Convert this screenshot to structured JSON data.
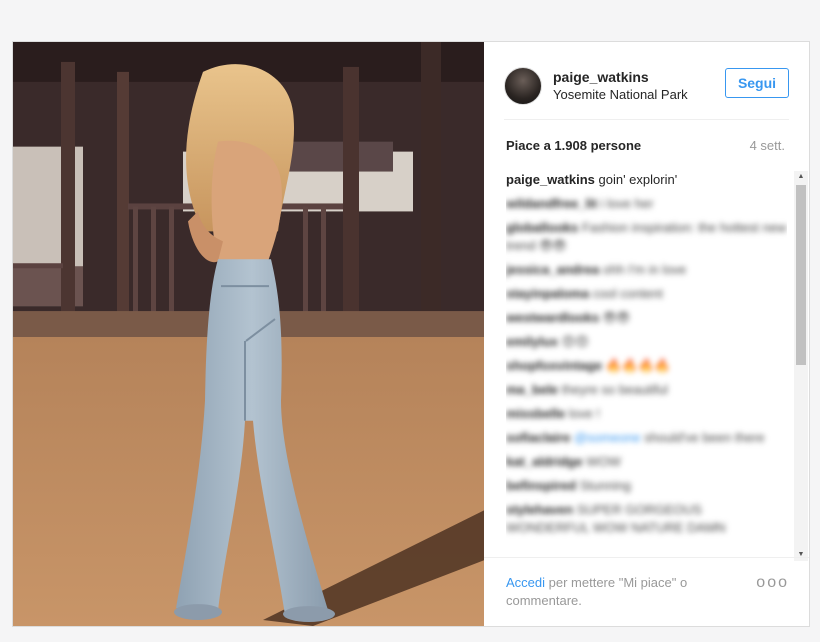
{
  "header": {
    "username": "paige_watkins",
    "location": "Yosemite National Park",
    "follow_label": "Segui"
  },
  "likes": {
    "text": "Piace a 1.908 persone",
    "time": "4 sett."
  },
  "caption": {
    "user": "paige_watkins",
    "text": "goin' explorin'"
  },
  "comments": [
    {
      "user": "wildandfree_lit",
      "text": "i love her"
    },
    {
      "user": "globallooks",
      "text": "Fashion inspiration: the hottest new trend 😎😎"
    },
    {
      "user": "jessica_andrea",
      "text": "ohh I'm in love"
    },
    {
      "user": "stayinpaloma",
      "text": "cool content"
    },
    {
      "user": "westwardlooks",
      "text": "😎😎"
    },
    {
      "user": "emilylux",
      "text": "😍😍"
    },
    {
      "user": "shopfoxvintage",
      "text": "🔥🔥🔥🔥"
    },
    {
      "user": "ma_bele",
      "text": "theyre so beautiful"
    },
    {
      "user": "missbelle",
      "text": "love !"
    },
    {
      "user": "sofiaclaire",
      "mention": "@someone",
      "text": "should've been there"
    },
    {
      "user": "kat_aldridge",
      "text": "WOW"
    },
    {
      "user": "befinspired",
      "text": "Stunning"
    },
    {
      "user": "stylehaven",
      "text": "SUPER GORGEOUS WONDERFUL WOW NATURE DAMN"
    }
  ],
  "footer": {
    "login_label": "Accedi",
    "rest": " per mettere \"Mi piace\" o commentare.",
    "more": "ooo"
  },
  "colors": {
    "accent": "#3897f0",
    "text": "#262626",
    "muted": "#999999"
  },
  "icons": {
    "more": "ellipsis-icon"
  }
}
